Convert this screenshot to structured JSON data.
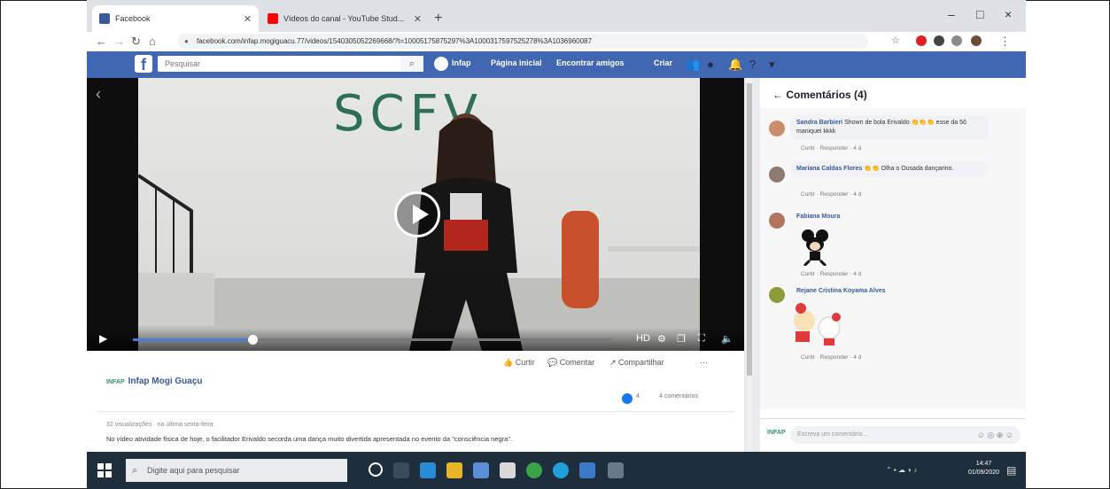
{
  "browser": {
    "tabs": [
      {
        "title": "Facebook",
        "icon": "facebook-icon",
        "color": "#3b5998"
      },
      {
        "title": "Vídeos do canal - YouTube Stud...",
        "icon": "youtube-icon",
        "color": "#ff0000"
      }
    ],
    "url": "facebook.com/infap.mogiguacu.77/videos/1540305052269668/?t=10005175875297%3A1000317597525278%3A1036960087",
    "new_tab_symbol": "+",
    "window_controls": [
      "–",
      "□",
      "×"
    ]
  },
  "facebook": {
    "logo": "f",
    "search_placeholder": "Pesquisar",
    "nav": [
      "Infap",
      "Página inicial",
      "Encontrar amigos",
      "Criar"
    ],
    "brand_color": "#4267b2"
  },
  "video": {
    "wall_text": "SCFV",
    "progress": 0.25
  },
  "post": {
    "page_name": "Infap Mogi Guaçu",
    "page_logo": "INFAP",
    "actions": [
      "Curtir",
      "Comentar",
      "Compartilhar",
      "···"
    ],
    "reaction_count": "4",
    "comment_count": "4 comentários",
    "views": "32 visualizações · na última sexta-feira",
    "description": "No vídeo atividade física de hoje, o facilitador Erivaldo secorda uma dança muito divertida apresentada no evento da \"consciência negra\"."
  },
  "comments": {
    "header": "Comentários (4)",
    "items": [
      {
        "name": "Sandra Barbieri",
        "text": "Shown de bola Erivaldo 👏👏👏 esse da 5ô maniquei kkkk",
        "actions": "Curtir · Responder · 4 d",
        "avatar_color": "#c98d6b"
      },
      {
        "name": "Mariana Caldas Flores",
        "text": "👏👏 Olha o Ousada dançarino.",
        "actions": "Curtir · Responder · 4 d",
        "avatar_color": "#8c7a70"
      },
      {
        "name": "Fabiana Moura",
        "text": "",
        "actions": "Curtir · Responder · 4 d",
        "avatar_color": "#b3745f"
      },
      {
        "name": "Rejane Cristina Koyama Alves",
        "text": "",
        "actions": "Curtir · Responder · 4 d",
        "avatar_color": "#8f9a3b"
      }
    ],
    "composer_placeholder": "Escreva um comentário..."
  },
  "taskbar": {
    "search_placeholder": "Digite aqui para pesquisar",
    "time": "14:47",
    "date": "01/09/2020"
  }
}
